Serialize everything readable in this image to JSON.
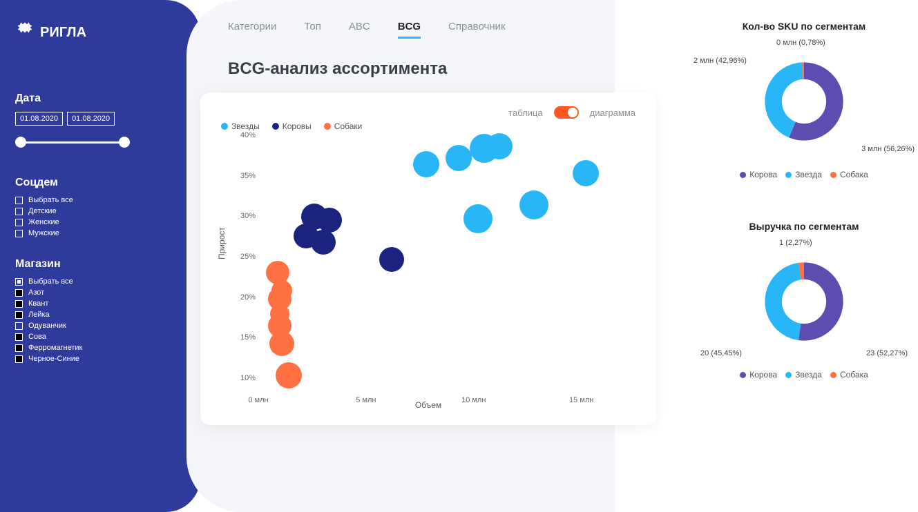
{
  "brand": "РИГЛА",
  "sidebar": {
    "date_heading": "Дата",
    "date_from": "01.08.2020",
    "date_to": "01.08.2020",
    "socdem_heading": "Соцдем",
    "socdem_items": [
      {
        "label": "Выбрать все",
        "checked": false
      },
      {
        "label": "Детские",
        "checked": false
      },
      {
        "label": "Женские",
        "checked": false
      },
      {
        "label": "Мужские",
        "checked": false
      }
    ],
    "store_heading": "Магазин",
    "store_items": [
      {
        "label": "Выбрать все",
        "style": "outline-checked"
      },
      {
        "label": "Азот",
        "style": "filled"
      },
      {
        "label": "Квант",
        "style": "filled"
      },
      {
        "label": "Лейка",
        "style": "filled"
      },
      {
        "label": "Одуванчик",
        "style": "outline"
      },
      {
        "label": "Сова",
        "style": "filled"
      },
      {
        "label": "Ферромагнетик",
        "style": "filled"
      },
      {
        "label": "Черное-Синие",
        "style": "filled"
      }
    ]
  },
  "tabs": [
    {
      "label": "Категории",
      "active": false
    },
    {
      "label": "Топ",
      "active": false
    },
    {
      "label": "ABC",
      "active": false
    },
    {
      "label": "BCG",
      "active": true
    },
    {
      "label": "Справочник",
      "active": false
    }
  ],
  "page_title": "BCG-анализ ассортимента",
  "scatter_toggle": {
    "left": "таблица",
    "right": "диаграмма"
  },
  "series_legend": [
    {
      "label": "Звезды",
      "class": "stars"
    },
    {
      "label": "Коровы",
      "class": "cows"
    },
    {
      "label": "Собаки",
      "class": "dogs"
    }
  ],
  "donut1_title": "Кол-во SKU по сегментам",
  "donut2_title": "Выручка по сегментам",
  "donut_legend": [
    {
      "label": "Корова",
      "class": "korova"
    },
    {
      "label": "Звезда",
      "class": "zv"
    },
    {
      "label": "Собака",
      "class": "sob"
    }
  ],
  "chart_data": [
    {
      "id": "bcg_scatter",
      "type": "scatter",
      "title": "BCG-анализ ассортимента",
      "xlabel": "Объем",
      "ylabel": "Прирост",
      "xlim": [
        0,
        17
      ],
      "ylim": [
        10,
        40
      ],
      "x_ticks": [
        {
          "v": 0,
          "l": "0 млн"
        },
        {
          "v": 5,
          "l": "5 млн"
        },
        {
          "v": 10,
          "l": "10 млн"
        },
        {
          "v": 15,
          "l": "15 млн"
        }
      ],
      "y_ticks": [
        {
          "v": 10,
          "l": "10%"
        },
        {
          "v": 15,
          "l": "15%"
        },
        {
          "v": 20,
          "l": "20%"
        },
        {
          "v": 25,
          "l": "25%"
        },
        {
          "v": 30,
          "l": "30%"
        },
        {
          "v": 35,
          "l": "35%"
        },
        {
          "v": 40,
          "l": "40%"
        }
      ],
      "series": [
        {
          "name": "Звезды",
          "color": "#29b6f6",
          "points": [
            {
              "x": 7.8,
              "y": 37.2,
              "r": 19
            },
            {
              "x": 9.3,
              "y": 38.0,
              "r": 19
            },
            {
              "x": 10.5,
              "y": 39.2,
              "r": 21
            },
            {
              "x": 11.2,
              "y": 39.5,
              "r": 19
            },
            {
              "x": 15.2,
              "y": 36.0,
              "r": 19
            },
            {
              "x": 10.2,
              "y": 30.2,
              "r": 21
            },
            {
              "x": 12.8,
              "y": 32.0,
              "r": 21
            }
          ]
        },
        {
          "name": "Коровы",
          "color": "#1a237e",
          "points": [
            {
              "x": 2.2,
              "y": 28.0,
              "r": 18
            },
            {
              "x": 2.6,
              "y": 30.5,
              "r": 19
            },
            {
              "x": 3.3,
              "y": 30.0,
              "r": 18
            },
            {
              "x": 3.0,
              "y": 27.2,
              "r": 18
            },
            {
              "x": 6.2,
              "y": 25.0,
              "r": 18
            }
          ]
        },
        {
          "name": "Собаки",
          "color": "#ff7043",
          "points": [
            {
              "x": 0.9,
              "y": 23.3,
              "r": 17
            },
            {
              "x": 1.1,
              "y": 21.0,
              "r": 15
            },
            {
              "x": 1.0,
              "y": 20.0,
              "r": 17
            },
            {
              "x": 1.0,
              "y": 18.0,
              "r": 14
            },
            {
              "x": 1.0,
              "y": 16.5,
              "r": 17
            },
            {
              "x": 1.1,
              "y": 14.2,
              "r": 18
            },
            {
              "x": 1.4,
              "y": 10.2,
              "r": 19
            }
          ]
        }
      ]
    },
    {
      "id": "sku_donut",
      "type": "pie",
      "title": "Кол-во SKU по сегментам",
      "series": [
        {
          "name": "Корова",
          "value": 3,
          "pct": 56.26,
          "color": "#5c4db1",
          "label": "3 млн (56,26%)"
        },
        {
          "name": "Звезда",
          "value": 2,
          "pct": 42.96,
          "color": "#29b6f6",
          "label": "2 млн (42,96%)"
        },
        {
          "name": "Собака",
          "value": 0,
          "pct": 0.78,
          "color": "#ff7043",
          "label": "0 млн (0,78%)"
        }
      ]
    },
    {
      "id": "revenue_donut",
      "type": "pie",
      "title": "Выручка по сегментам",
      "series": [
        {
          "name": "Корова",
          "value": 23,
          "pct": 52.27,
          "color": "#5c4db1",
          "label": "23 (52,27%)"
        },
        {
          "name": "Звезда",
          "value": 20,
          "pct": 45.45,
          "color": "#29b6f6",
          "label": "20 (45,45%)"
        },
        {
          "name": "Собака",
          "value": 1,
          "pct": 2.27,
          "color": "#ff7043",
          "label": "1 (2,27%)"
        }
      ]
    }
  ]
}
